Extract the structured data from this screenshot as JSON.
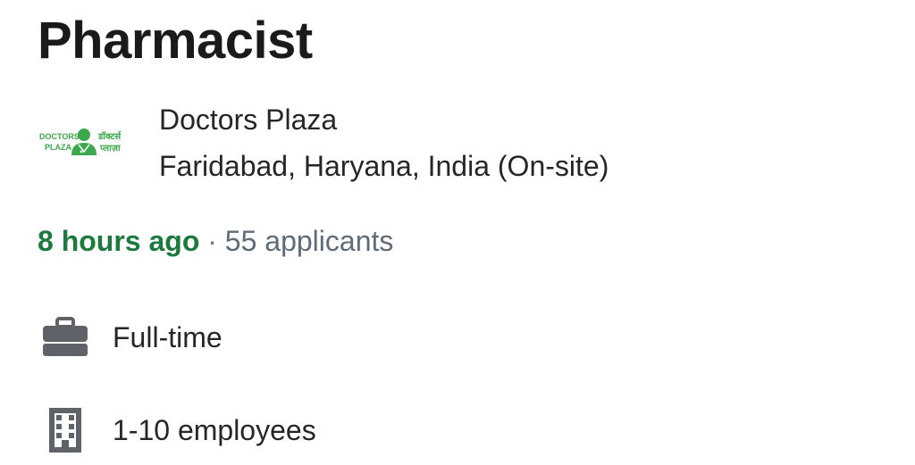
{
  "job": {
    "title": "Pharmacist"
  },
  "company": {
    "name": "Doctors Plaza",
    "location": "Faridabad, Haryana, India (On-site)",
    "logo": {
      "text_en_line1": "DOCTORS",
      "text_en_line2": "PLAZA",
      "text_hi_line1": "डॉक्टर्स",
      "text_hi_line2": "प्लाज़ा",
      "color": "#3aa84b"
    }
  },
  "meta": {
    "posted": "8 hours ago",
    "separator": " · ",
    "applicants": "55 applicants",
    "posted_color": "#1c7a3c"
  },
  "details": {
    "job_type": {
      "icon": "briefcase-icon",
      "label": "Full-time"
    },
    "company_size": {
      "icon": "building-icon",
      "label": "1-10 employees"
    }
  }
}
